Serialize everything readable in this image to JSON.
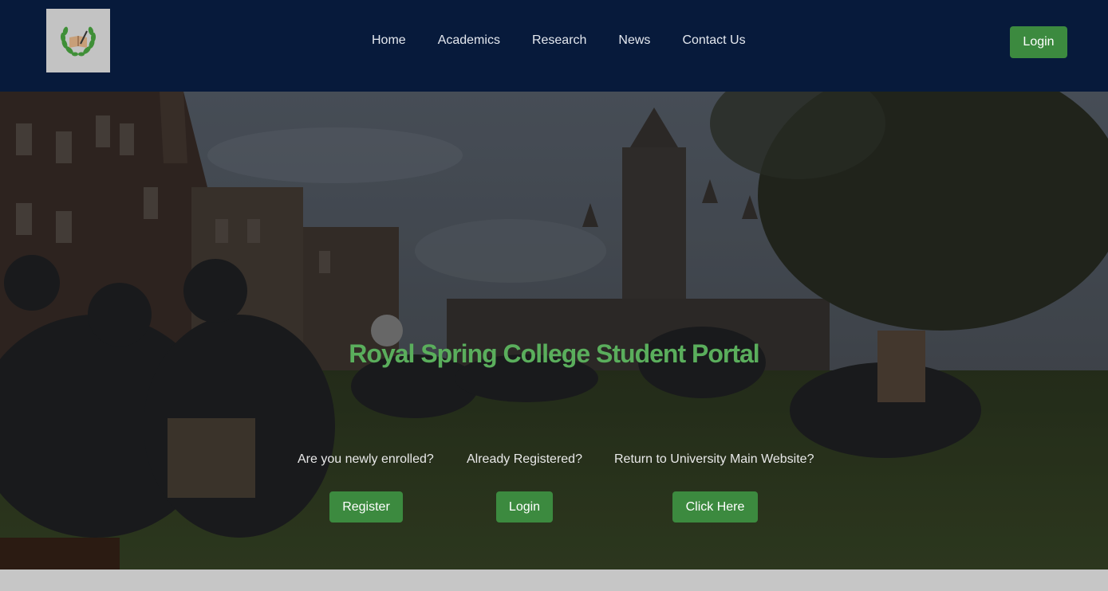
{
  "nav": {
    "logo_icon": "laurel-book-emblem",
    "links": [
      "Home",
      "Academics",
      "Research",
      "News",
      "Contact Us"
    ],
    "login_label": "Login"
  },
  "hero": {
    "title": "Royal Spring College Student Portal",
    "actions": [
      {
        "prompt": "Are you newly enrolled?",
        "button": "Register"
      },
      {
        "prompt": "Already Registered?",
        "button": "Login"
      },
      {
        "prompt": "Return to University Main Website?",
        "button": "Click Here"
      }
    ]
  },
  "colors": {
    "navbar": "#071a3b",
    "accent_green": "#3c8a3f",
    "title_green": "#5aae5c"
  }
}
